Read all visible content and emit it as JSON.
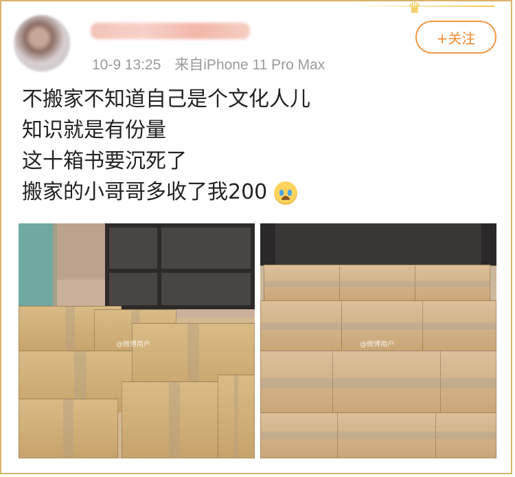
{
  "post": {
    "timestamp": "10-9 13:25",
    "source_prefix": "来自",
    "device": "iPhone 11 Pro Max",
    "follow_label": "+关注",
    "lines": [
      "不搬家不知道自己是个文化人儿",
      "知识就是有份量",
      "这十箱书要沉死了",
      "搬家的小哥哥多收了我200"
    ]
  },
  "icons": {
    "emoji": "crying-emoji",
    "crown": "crown-icon"
  },
  "colors": {
    "frame": "#d9b36a",
    "follow_accent": "#f08a2e",
    "meta_text": "#9a9a9a"
  }
}
